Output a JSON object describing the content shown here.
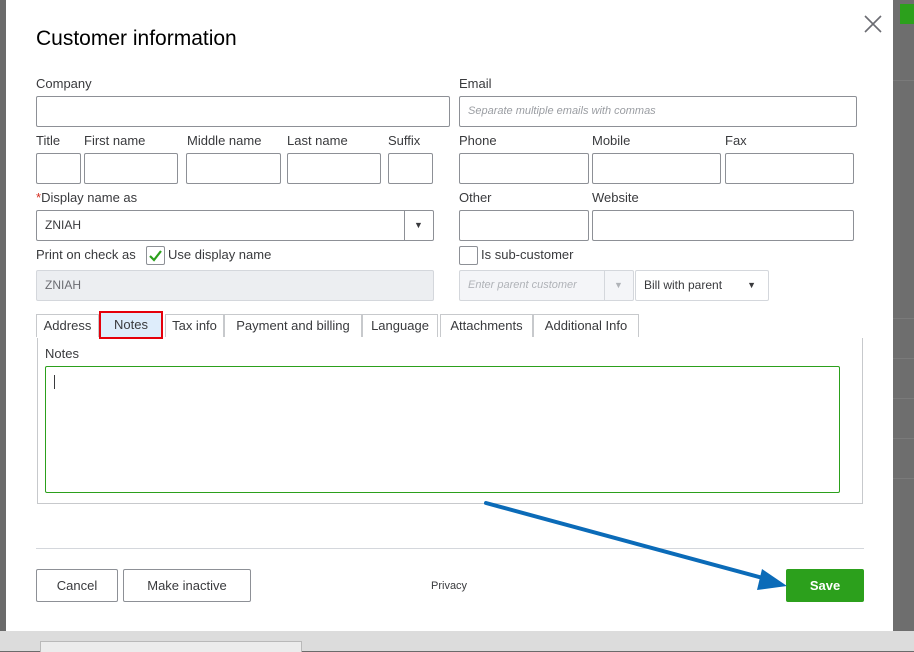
{
  "dialog": {
    "title": "Customer information",
    "close_icon": "close-icon"
  },
  "fields": {
    "company_label": "Company",
    "email_label": "Email",
    "email_placeholder": "Separate multiple emails with commas",
    "title_label": "Title",
    "first_name_label": "First name",
    "middle_name_label": "Middle name",
    "last_name_label": "Last name",
    "suffix_label": "Suffix",
    "phone_label": "Phone",
    "mobile_label": "Mobile",
    "fax_label": "Fax",
    "display_name_required": "*",
    "display_name_label": "Display name as",
    "display_name_value": "ZNIAH",
    "other_label": "Other",
    "website_label": "Website",
    "print_on_check_label": "Print on check as",
    "use_display_name_label": "Use display name",
    "use_display_name_checked": true,
    "print_on_check_value": "ZNIAH",
    "sub_customer_label": "Is sub-customer",
    "sub_customer_checked": false,
    "parent_customer_placeholder": "Enter parent customer",
    "bill_with_parent_value": "Bill with parent"
  },
  "tabs": [
    {
      "label": "Address",
      "active": false
    },
    {
      "label": "Notes",
      "active": true
    },
    {
      "label": "Tax info",
      "active": false
    },
    {
      "label": "Payment and billing",
      "active": false
    },
    {
      "label": "Language",
      "active": false
    },
    {
      "label": "Attachments",
      "active": false
    },
    {
      "label": "Additional Info",
      "active": false
    }
  ],
  "notes": {
    "label": "Notes",
    "value": ""
  },
  "footer": {
    "cancel_label": "Cancel",
    "make_inactive_label": "Make inactive",
    "privacy_label": "Privacy",
    "save_label": "Save"
  },
  "colors": {
    "accent_green": "#2ca01c",
    "highlight_red": "#e5000b",
    "annotation_arrow": "#0b6bb8"
  }
}
